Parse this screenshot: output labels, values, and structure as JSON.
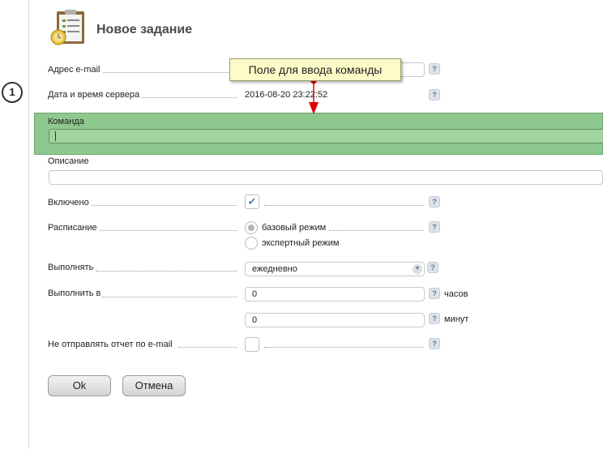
{
  "step_number": "1",
  "title": "Новое задание",
  "tooltip": "Поле для ввода команды",
  "help_mark": "?",
  "fields": {
    "email": {
      "label": "Адрес e-mail",
      "value": ""
    },
    "server_time": {
      "label": "Дата и время сервера",
      "value": "2016-08-20 23:22:52"
    },
    "command": {
      "label": "Команда",
      "value": ""
    },
    "description": {
      "label": "Описание",
      "value": ""
    },
    "enabled": {
      "label": "Включено",
      "checked": true
    },
    "schedule": {
      "label": "Расписание",
      "options": [
        "базовый режим",
        "экспертный режим"
      ],
      "selected": "базовый режим"
    },
    "run": {
      "label": "Выполнять",
      "value": "ежедневно"
    },
    "run_at": {
      "label": "Выполнить в",
      "hours": "0",
      "hours_unit": "часов",
      "minutes": "0",
      "minutes_unit": "минут"
    },
    "no_report": {
      "label": "Не отправлять отчет по e-mail",
      "checked": false
    }
  },
  "buttons": {
    "ok": "Ok",
    "cancel": "Отмена"
  },
  "colors": {
    "highlight": "#8fc88f",
    "tooltip_bg": "#fdfbc8",
    "pointer": "#e00000"
  }
}
